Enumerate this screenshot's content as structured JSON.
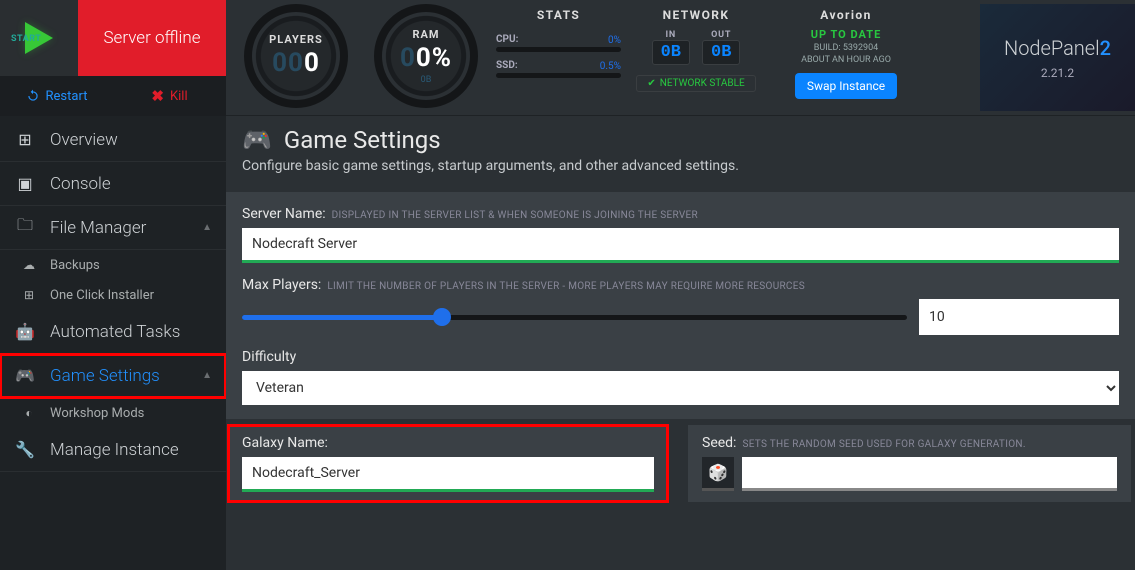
{
  "status": {
    "label": "Server offline",
    "start_label": "START"
  },
  "controls": {
    "restart": "Restart",
    "kill": "Kill"
  },
  "sidebar": {
    "items": [
      {
        "label": "Overview"
      },
      {
        "label": "Console"
      },
      {
        "label": "File Manager",
        "sub": [
          {
            "label": "Backups"
          },
          {
            "label": "One Click Installer"
          }
        ]
      },
      {
        "label": "Automated Tasks"
      },
      {
        "label": "Game Settings",
        "active": true,
        "sub": [
          {
            "label": "Workshop Mods"
          }
        ]
      },
      {
        "label": "Manage Instance"
      }
    ]
  },
  "dials": {
    "players": {
      "label": "PLAYERS",
      "value": "0",
      "value_dim_prefix": "00"
    },
    "ram": {
      "label": "RAM",
      "value": "0%",
      "value_dim_prefix": "0",
      "sub": "0B"
    }
  },
  "stats": {
    "title": "STATS",
    "cpu": {
      "label": "CPU:",
      "pct": "0%"
    },
    "ssd": {
      "label": "SSD:",
      "pct": "0.5%"
    }
  },
  "network": {
    "title": "NETWORK",
    "in": {
      "label": "IN",
      "value": "0B"
    },
    "out": {
      "label": "OUT",
      "value": "0B"
    },
    "stable": "NETWORK STABLE"
  },
  "game": {
    "name": "Avorion",
    "up": "UP TO DATE",
    "build_label": "BUILD:",
    "build": "5392904",
    "ago": "ABOUT AN HOUR AGO",
    "swap": "Swap Instance"
  },
  "brand": {
    "name": "NodePanel",
    "suffix": "2",
    "version": "2.21.2"
  },
  "page": {
    "title": "Game Settings",
    "subtitle": "Configure basic game settings, startup arguments, and other advanced settings.",
    "server_name": {
      "label": "Server Name:",
      "hint": "DISPLAYED IN THE SERVER LIST & WHEN SOMEONE IS JOINING THE SERVER",
      "value": "Nodecraft Server"
    },
    "max_players": {
      "label": "Max Players:",
      "hint": "LIMIT THE NUMBER OF PLAYERS IN THE SERVER - MORE PLAYERS MAY REQUIRE MORE RESOURCES",
      "value": "10",
      "slider_pct": 30
    },
    "difficulty": {
      "label": "Difficulty",
      "value": "Veteran"
    },
    "galaxy": {
      "label": "Galaxy Name:",
      "value": "Nodecraft_Server"
    },
    "seed": {
      "label": "Seed:",
      "hint": "SETS THE RANDOM SEED USED FOR GALAXY GENERATION.",
      "value": ""
    }
  }
}
